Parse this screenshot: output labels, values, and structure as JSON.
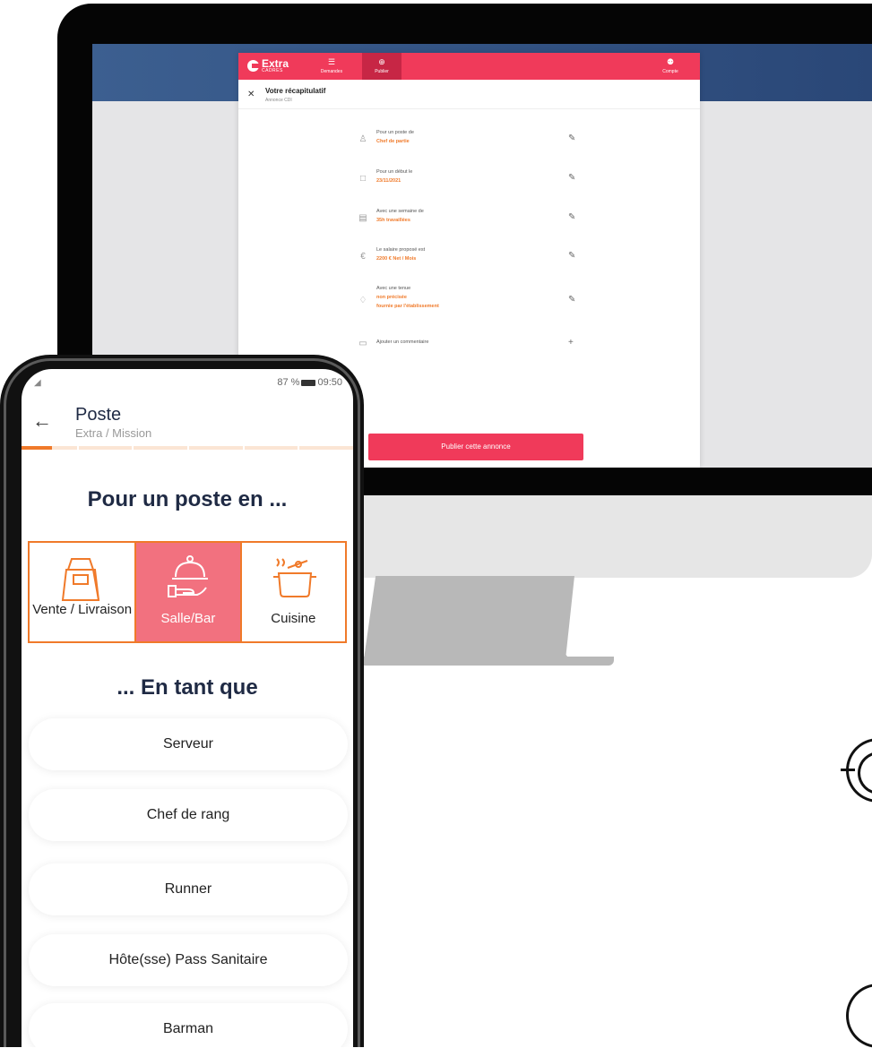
{
  "desktop": {
    "logo": {
      "text": "Extra",
      "sub": "CADRES"
    },
    "nav": [
      {
        "label": "Demandes",
        "icon": "stack-icon"
      },
      {
        "label": "Publier",
        "icon": "plus-circle-icon"
      },
      {
        "label": "Compte",
        "icon": "user-icon"
      }
    ],
    "recap": {
      "title": "Votre récapitulatif",
      "subtitle": "Annonce CDI",
      "rows": [
        {
          "label": "Pour un poste de",
          "value": "Chef de partie",
          "icon": "user-icon",
          "glyph": "♙"
        },
        {
          "label": "Pour un début le",
          "value": "23/11/2021",
          "icon": "calendar-icon",
          "glyph": "□"
        },
        {
          "label": "Avec une semaine de",
          "value": "35h travaillées",
          "icon": "calendar-week-icon",
          "glyph": "▤"
        },
        {
          "label": "Le salaire proposé est",
          "value": "2200 € Net / Mois",
          "icon": "euro-icon",
          "glyph": "€"
        },
        {
          "label": "Avec une tenue",
          "value": "non précisée",
          "value2": "fournie par l'établissement",
          "icon": "uniform-icon",
          "glyph": "♢"
        }
      ],
      "comment": {
        "label": "Ajouter un commentaire",
        "icon": "comment-icon"
      },
      "publish_label": "Publier cette annonce"
    }
  },
  "phone": {
    "status": {
      "battery": "87 %",
      "time": "09:50"
    },
    "header": {
      "title": "Poste",
      "subtitle": "Extra / Mission"
    },
    "progress": {
      "current_step": 1,
      "total_steps": 6
    },
    "section1_title": "Pour un poste en ...",
    "categories": [
      {
        "label": "Vente / Livraison",
        "icon": "shopping-bag-icon",
        "selected": false
      },
      {
        "label": "Salle/Bar",
        "icon": "cloche-serving-icon",
        "selected": true
      },
      {
        "label": "Cuisine",
        "icon": "cooking-pot-icon",
        "selected": false
      }
    ],
    "section2_title": "... En tant que",
    "roles": [
      "Serveur",
      "Chef de rang",
      "Runner",
      "Hôte(sse) Pass Sanitaire",
      "Barman"
    ]
  },
  "colors": {
    "brand_red": "#f03a5a",
    "accent_orange": "#f07a2a",
    "selected_tile": "#f2717f",
    "heading_navy": "#1f2a44"
  }
}
